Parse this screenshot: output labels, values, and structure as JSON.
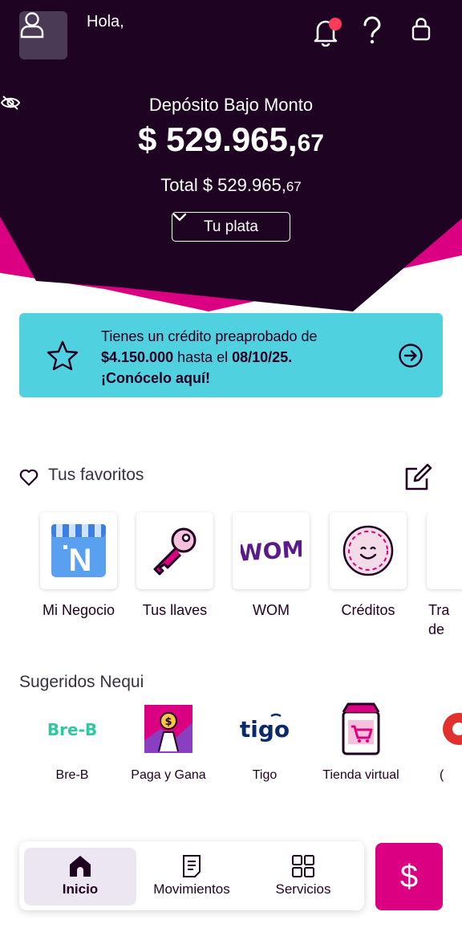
{
  "header": {
    "greeting": "Hola,",
    "icons": [
      "user-icon",
      "bell-icon",
      "help-icon",
      "lock-icon"
    ]
  },
  "balance": {
    "label": "Depósito Bajo Monto",
    "currency": "$",
    "amount_main": "529.965,",
    "amount_cents": "67",
    "total_prefix": "Total $ 529.965,",
    "total_cents": "67",
    "tuplata_label": "Tu plata"
  },
  "promo": {
    "line1": "Tienes un crédito preaprobado de",
    "amount": "$4.150.000",
    "mid": " hasta el ",
    "date": "08/10/25.",
    "cta": "¡Conócelo aquí!"
  },
  "favorites": {
    "title": "Tus favoritos",
    "items": [
      {
        "label": "Mi Negocio"
      },
      {
        "label": "Tus llaves"
      },
      {
        "label": "WOM"
      },
      {
        "label": "Créditos"
      },
      {
        "label": "Tra de"
      }
    ]
  },
  "suggested": {
    "title": "Sugeridos Nequi",
    "items": [
      {
        "label": "Bre-B"
      },
      {
        "label": "Paga y Gana"
      },
      {
        "label": "Tigo"
      },
      {
        "label": "Tienda virtual"
      },
      {
        "label": "("
      }
    ]
  },
  "nav": {
    "items": [
      {
        "label": "Inicio"
      },
      {
        "label": "Movimientos"
      },
      {
        "label": "Servicios"
      }
    ],
    "pay_symbol": "$"
  },
  "colors": {
    "hero": "#1e0322",
    "magenta": "#da0081",
    "promo": "#4fd1e0"
  }
}
